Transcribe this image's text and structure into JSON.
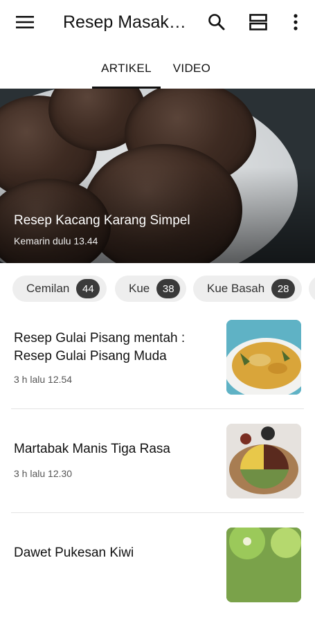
{
  "app": {
    "title": "Resep Masak…",
    "icons": {
      "menu": "hamburger-menu-icon",
      "search": "search-icon",
      "layout": "view-layout-icon",
      "more": "more-vertical-icon"
    }
  },
  "tabs": [
    {
      "label": "ARTIKEL",
      "active": true
    },
    {
      "label": "VIDEO",
      "active": false
    }
  ],
  "hero": {
    "title": "Resep Kacang Karang Simpel",
    "time": "Kemarin dulu 13.44"
  },
  "chips": [
    {
      "label": "Cemilan",
      "count": "44"
    },
    {
      "label": "Kue",
      "count": "38"
    },
    {
      "label": "Kue Basah",
      "count": "28"
    }
  ],
  "articles": [
    {
      "title": "Resep Gulai Pisang mentah : Resep Gulai Pisang Muda",
      "time": "3 h lalu 12.54"
    },
    {
      "title": "Martabak Manis Tiga Rasa",
      "time": "3 h lalu 12.30"
    },
    {
      "title": "Dawet Pukesan Kiwi",
      "time": ""
    }
  ],
  "colors": {
    "accent": "#111111",
    "chip_bg": "#eeeeee",
    "badge_bg": "#3a3a3a"
  }
}
